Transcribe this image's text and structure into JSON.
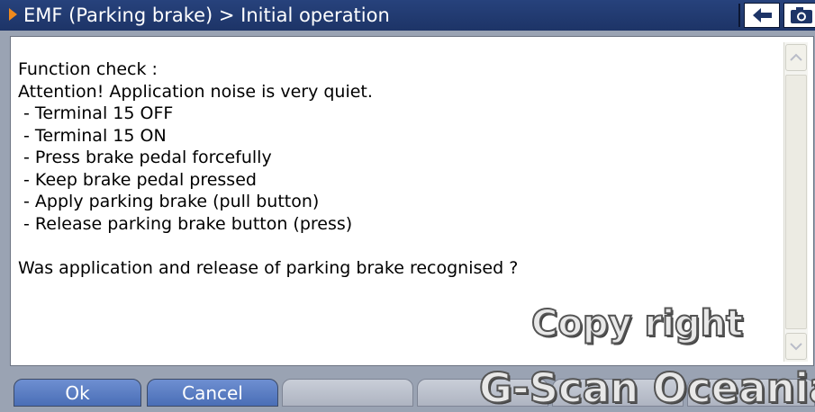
{
  "window": {
    "title": "EMF (Parking brake) > Initial operation",
    "back_icon": "back-arrow-icon",
    "camera_icon": "camera-icon",
    "title_arrow_color": "#f08a1c"
  },
  "message": {
    "lines": [
      "Function check :",
      "Attention! Application noise is very quiet.",
      " - Terminal 15 OFF",
      " - Terminal 15 ON",
      " - Press brake pedal forcefully",
      " - Keep brake pedal pressed",
      " - Apply parking brake (pull button)",
      " - Release parking brake button (press)",
      "",
      "Was application and release of parking brake recognised ?"
    ]
  },
  "buttons": {
    "ok_label": "Ok",
    "cancel_label": "Cancel"
  },
  "watermark": {
    "line1": "Copy right",
    "line2": "G-Scan Oceania"
  }
}
